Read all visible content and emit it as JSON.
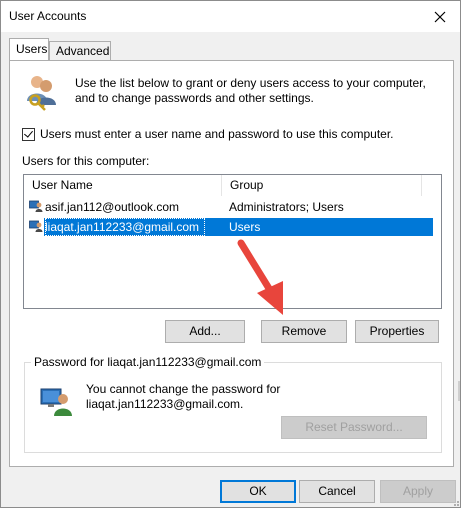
{
  "window": {
    "title": "User Accounts"
  },
  "tabs": [
    {
      "label": "Users",
      "active": true
    },
    {
      "label": "Advanced",
      "active": false
    }
  ],
  "intro": {
    "text_line1": "Use the list below to grant or deny users access to your computer,",
    "text_line2": "and to change passwords and other settings."
  },
  "require_login": {
    "label": "Users must enter a user name and password to use this computer.",
    "checked": true
  },
  "users_section": {
    "label": "Users for this computer:",
    "columns": [
      "User Name",
      "Group"
    ],
    "rows": [
      {
        "name": "asif.jan112@outlook.com",
        "group": "Administrators; Users",
        "selected": false
      },
      {
        "name": "liaqat.jan112233@gmail.com",
        "group": "Users",
        "selected": true
      }
    ]
  },
  "list_buttons": {
    "add": "Add...",
    "remove": "Remove",
    "properties": "Properties"
  },
  "password_group": {
    "label": "Password for liaqat.jan112233@gmail.com",
    "message_line1": "You cannot change the password for",
    "message_line2": "liaqat.jan112233@gmail.com.",
    "reset_button": "Reset Password..."
  },
  "dialog_buttons": {
    "ok": "OK",
    "cancel": "Cancel",
    "apply": "Apply"
  },
  "colors": {
    "selection": "#0078d7",
    "arrow": "#e8453c",
    "dialog_bg": "#f0f0f0"
  }
}
